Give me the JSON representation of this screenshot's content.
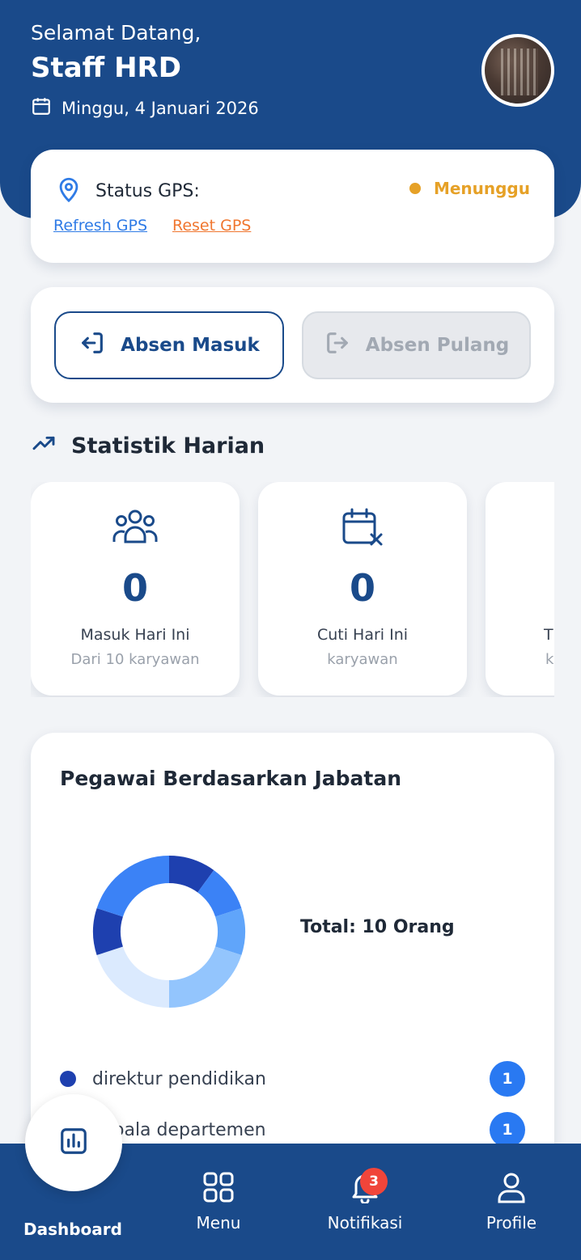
{
  "header": {
    "greeting": "Selamat Datang,",
    "user_name": "Staff HRD",
    "date": "Minggu, 4 Januari 2026",
    "icons": {
      "calendar": "calendar-icon",
      "avatar": "avatar"
    }
  },
  "gps": {
    "label": "Status GPS:",
    "status": "Menunggu",
    "refresh_label": "Refresh GPS",
    "reset_label": "Reset GPS",
    "status_color": "#e6a127"
  },
  "absen": {
    "masuk_label": "Absen Masuk",
    "pulang_label": "Absen Pulang"
  },
  "statistik": {
    "title": "Statistik Harian",
    "cards": [
      {
        "icon": "users-icon",
        "value": "0",
        "label": "Masuk Hari Ini",
        "sub": "Dari 10 karyawan"
      },
      {
        "icon": "calendar-x-icon",
        "value": "0",
        "label": "Cuti Hari Ini",
        "sub": "karyawan"
      },
      {
        "icon": "",
        "value": "",
        "label": "T",
        "sub": "k"
      }
    ]
  },
  "chart": {
    "title": "Pegawai Berdasarkan Jabatan",
    "total": "Total: 10 Orang",
    "legend": [
      {
        "label": "direktur pendidikan",
        "count": "1",
        "color": "#1e40af"
      },
      {
        "label": "kepala departemen",
        "count": "1",
        "color": "#2563eb"
      }
    ]
  },
  "chart_data": {
    "type": "pie",
    "title": "Pegawai Berdasarkan Jabatan",
    "categories": [
      "direktur pendidikan",
      "kepala departemen",
      "",
      "",
      "",
      "",
      ""
    ],
    "values": [
      1,
      1,
      1,
      2,
      2,
      1,
      2
    ],
    "colors": [
      "#1e40af",
      "#3b82f6",
      "#60a5fa",
      "#93c5fd",
      "#dbeafe",
      "#1e40af",
      "#3b82f6"
    ]
  },
  "nav": {
    "dashboard": "Dashboard",
    "menu": "Menu",
    "notifikasi": "Notifikasi",
    "profile": "Profile",
    "badge_count": "3"
  },
  "colors": {
    "primary": "#1a4a8a",
    "accent": "#2979f2",
    "warning": "#e6a127",
    "danger": "#f0453a"
  }
}
